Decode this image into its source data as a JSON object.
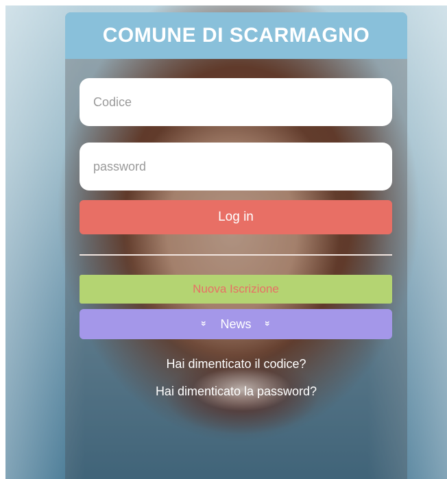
{
  "header": {
    "title": "COMUNE DI SCARMAGNO"
  },
  "login_form": {
    "code_placeholder": "Codice",
    "password_placeholder": "password",
    "login_label": "Log in"
  },
  "signup": {
    "label": "Nuova Iscrizione"
  },
  "news": {
    "label": "News",
    "icon": "double-chevron-down-icon"
  },
  "links": {
    "forgot_code": "Hai dimenticato il codice?",
    "forgot_password": "Hai dimenticato la password?"
  },
  "colors": {
    "header_bg": "#89c0da",
    "login_bg": "#e86f65",
    "signup_bg": "#b4d472",
    "news_bg": "#a497e9"
  }
}
